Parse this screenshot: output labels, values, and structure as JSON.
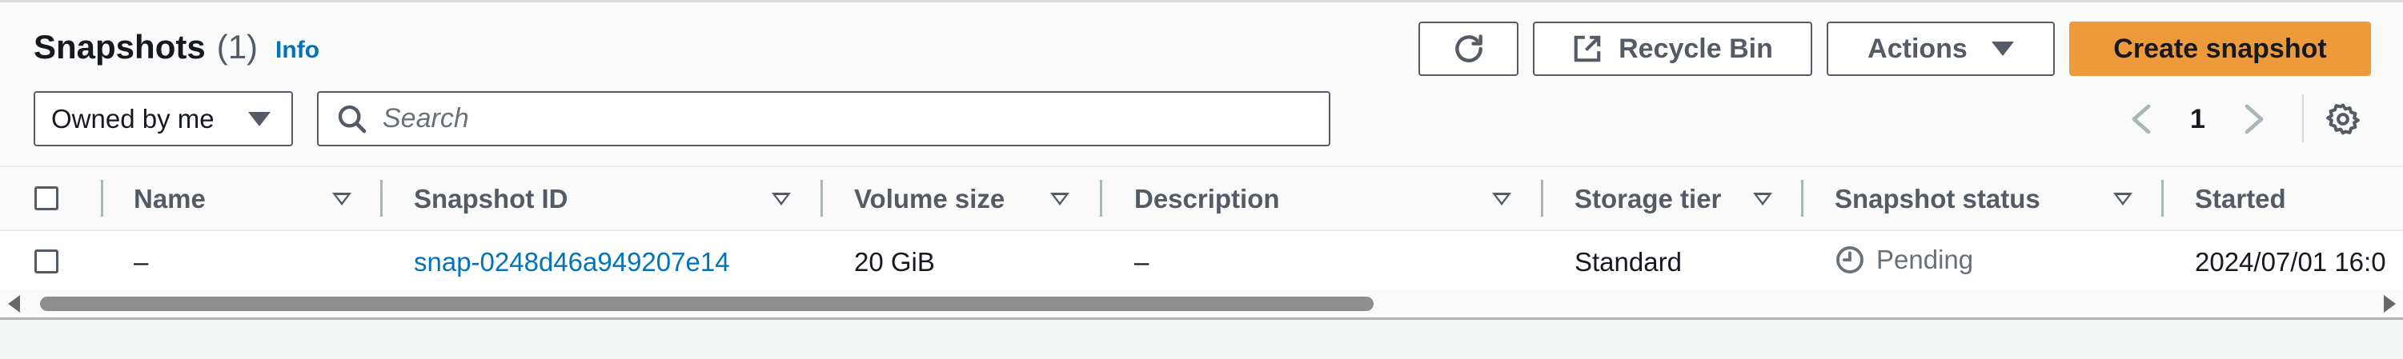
{
  "header": {
    "title": "Snapshots",
    "count": "(1)",
    "info_link": "Info"
  },
  "toolbar": {
    "refresh_icon": "refresh-icon",
    "recycle_bin_label": "Recycle Bin",
    "actions_label": "Actions",
    "create_snapshot_label": "Create snapshot",
    "create_button_color": "#ec9a3c"
  },
  "filters": {
    "owner_selected": "Owned by me",
    "search_placeholder": "Search",
    "search_value": ""
  },
  "pagination": {
    "current_page": "1"
  },
  "table": {
    "columns": [
      "Name",
      "Snapshot ID",
      "Volume size",
      "Description",
      "Storage tier",
      "Snapshot status",
      "Started"
    ],
    "rows": [
      {
        "name": "–",
        "snapshot_id": "snap-0248d46a949207e14",
        "volume_size": "20 GiB",
        "description": "–",
        "storage_tier": "Standard",
        "status": "Pending",
        "started": "2024/07/01 16:0"
      }
    ]
  },
  "colors": {
    "link": "#0073bb",
    "accent": "#ec9a3c",
    "status_pending": "#687078"
  }
}
